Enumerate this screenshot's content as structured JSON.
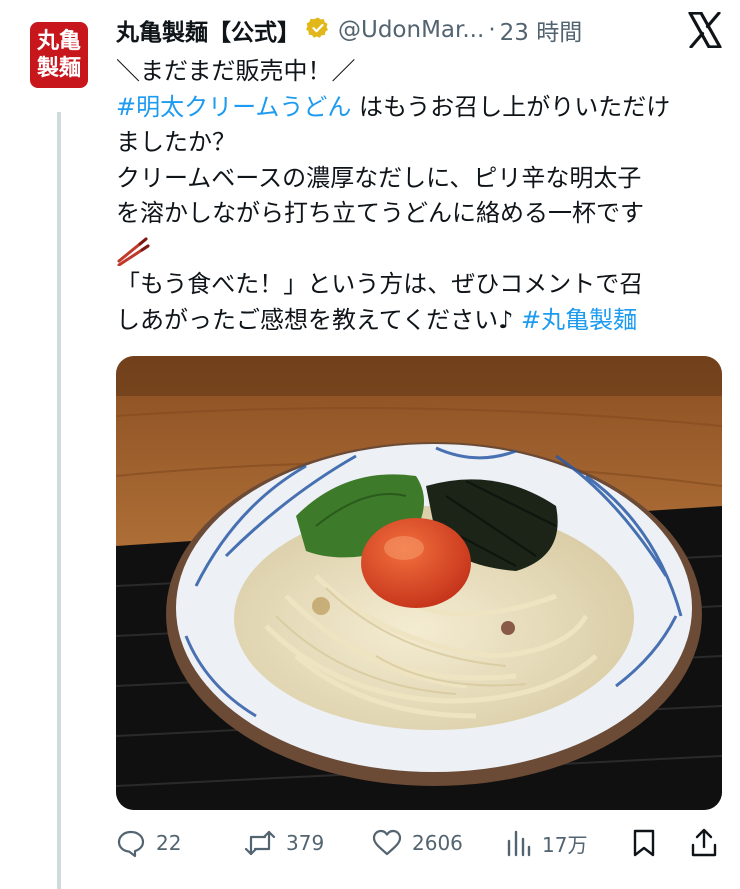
{
  "account": {
    "avatar_text_top": "丸亀",
    "avatar_text_bottom": "製麺",
    "display_name": "丸亀製麺【公式】",
    "handle": "@UdonMar...",
    "separator": "·",
    "time": "23 時間",
    "verified_color": "#e2b719"
  },
  "post": {
    "line1": "＼まだまだ販売中！／",
    "hashtag1": "#明太クリームうどん",
    "line2_rest": " はもうお召し上がりいただけ",
    "line3": "ましたか？",
    "line4": "クリームベースの濃厚なだしに、ピリ辛な明太子",
    "line5": "を溶かしながら打ち立てうどんに絡める一杯です",
    "line6_emoji": "chopsticks-emoji",
    "line7": "「もう食べた！」という方は、ぜひコメントで召",
    "line8": "しあがったご感想を教えてください♪ ",
    "hashtag2": "#丸亀製麺"
  },
  "image": {
    "description_icon": "mentaiko-cream-udon-photo"
  },
  "actions": {
    "replies": "22",
    "reposts": "379",
    "likes": "2606",
    "views": "17万"
  },
  "colors": {
    "accent": "#1d9bf0",
    "muted": "#536471",
    "brand": "#c8161d"
  }
}
